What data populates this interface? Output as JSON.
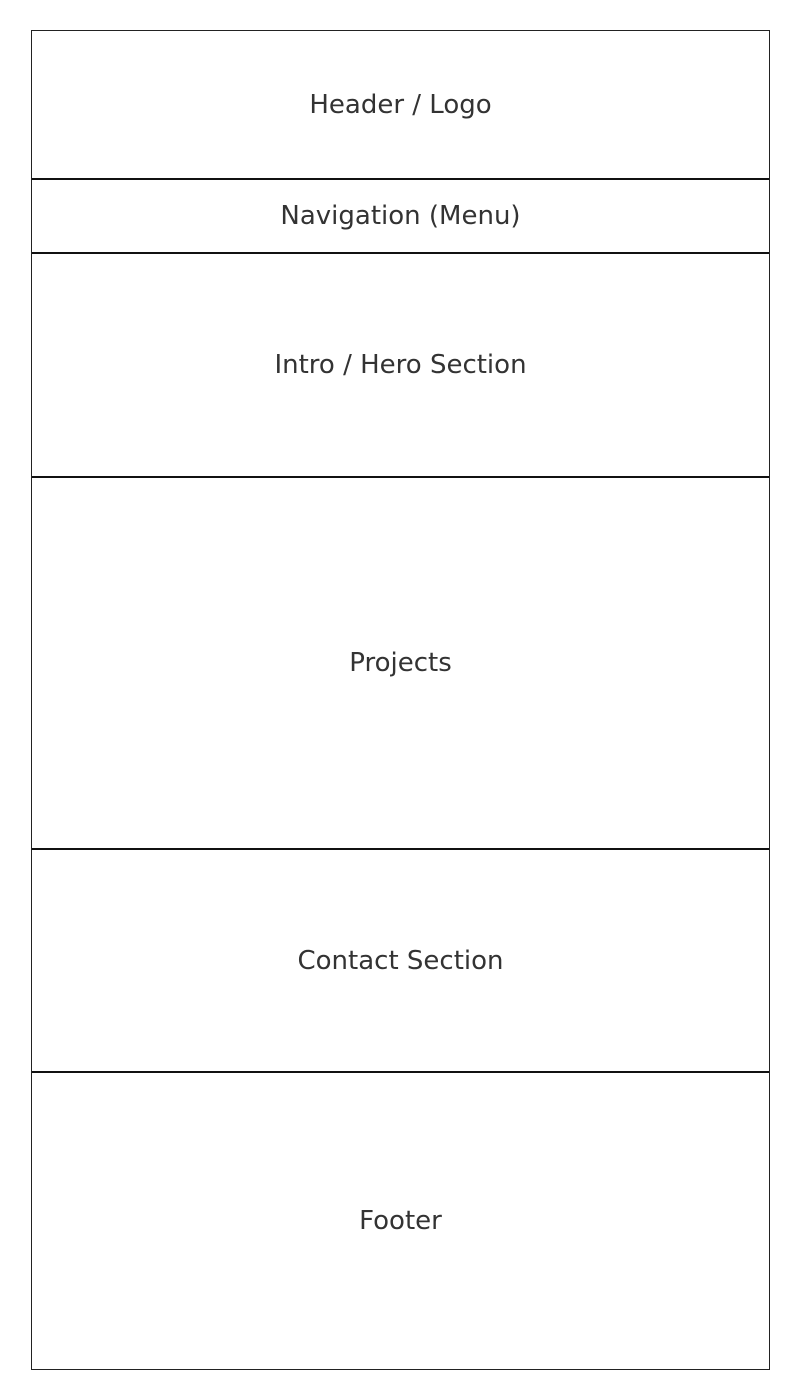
{
  "sections": {
    "header": "Header / Logo",
    "navigation": "Navigation (Menu)",
    "hero": "Intro / Hero Section",
    "projects": "Projects",
    "contact": "Contact Section",
    "footer": "Footer"
  }
}
